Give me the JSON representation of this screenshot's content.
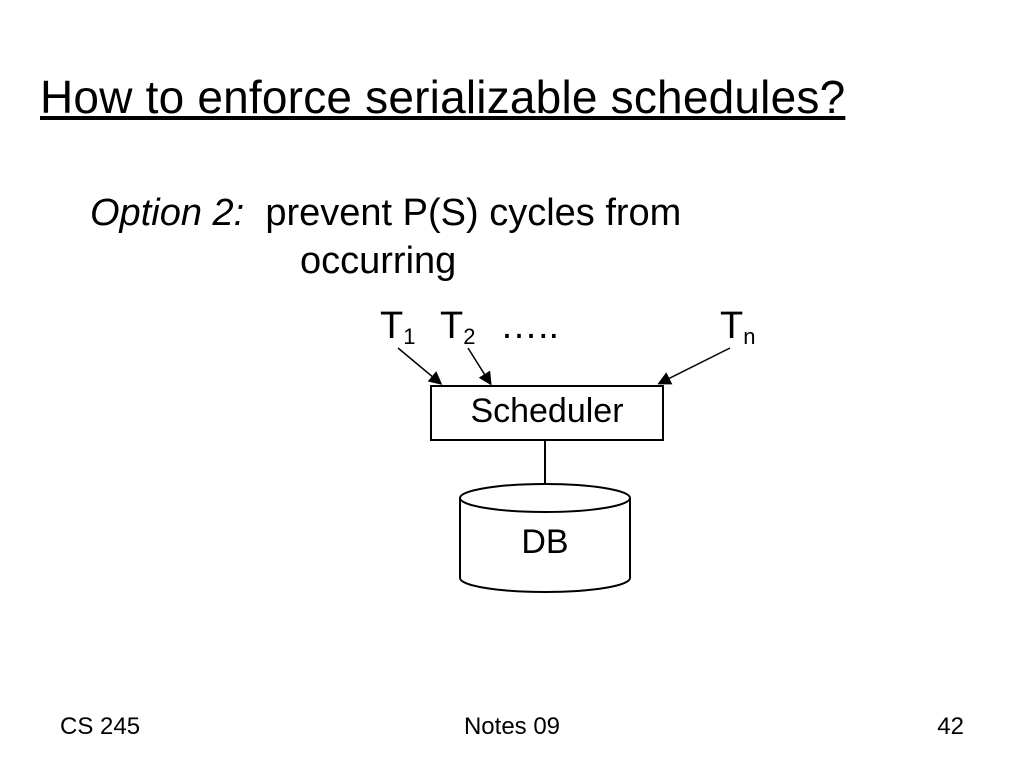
{
  "title": "How to enforce serializable schedules?",
  "option_label": "Option 2:",
  "option_text_line1": "prevent P(S) cycles from",
  "option_text_line2": "occurring",
  "transactions": {
    "t1": "T",
    "t1_sub": "1",
    "t2": "T",
    "t2_sub": "2",
    "dots": "…..",
    "tn": "T",
    "tn_sub": "n"
  },
  "scheduler_label": "Scheduler",
  "db_label": "DB",
  "footer": {
    "left": "CS 245",
    "center": "Notes 09",
    "right": "42"
  }
}
